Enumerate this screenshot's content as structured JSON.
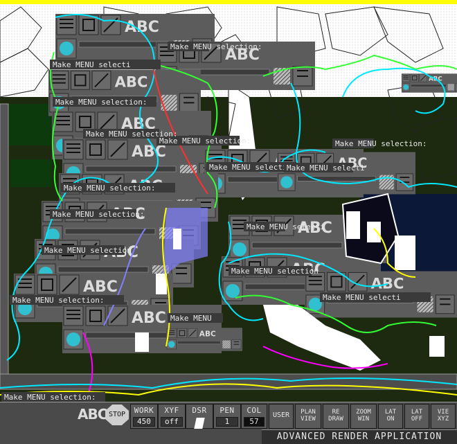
{
  "app": {
    "title": "ADVANCED RENDER APPLICATION"
  },
  "menu_prompt": "Make MENU selection:",
  "menu_labels": [
    "Make MENU selecti",
    "Make MENU selection:",
    "Make MENU selection:",
    "Make MENU selection:",
    "Make MENU selection:",
    "Make MENU selecti",
    "Make MENU selection:",
    "Make MENU selection",
    "Make MENU selection:",
    "Make MENU selection",
    "Make MENU selecti",
    "Make MENU",
    "Make MENU selection:",
    "Make MENU selecti",
    "Make MENU selection:",
    "Make MENU selection:",
    "Make MENU selection:"
  ],
  "icons": {
    "abc": "ABC",
    "stop": "STOP"
  },
  "toolbar": {
    "work": {
      "label": "WORK",
      "value": "450"
    },
    "xyf": {
      "label": "XYF",
      "value": "off"
    },
    "dsr": {
      "label": "DSR"
    },
    "pen": {
      "label": "PEN",
      "value": "1"
    },
    "col": {
      "label": "COL",
      "value": "57"
    },
    "user": "USER",
    "plan_view": [
      "PLAN",
      "VIEW"
    ],
    "redraw": [
      "RE",
      "DRAW"
    ],
    "zoom_win": [
      "ZOOM",
      "WIN"
    ],
    "lat_on": [
      "LAT",
      "ON"
    ],
    "lat_off": [
      "LAT",
      "OFF"
    ],
    "vie_xyz": [
      "VIE",
      "XYZ"
    ]
  },
  "colors": {
    "panel": "#5c5c5c",
    "outline_cyan": "#00e8ff",
    "outline_green": "#33ff33",
    "terrain_dark": "#1e2a10",
    "terrain_green": "#0c3a0c",
    "path_purple": "#8080ff",
    "yellow": "#ffff00"
  }
}
